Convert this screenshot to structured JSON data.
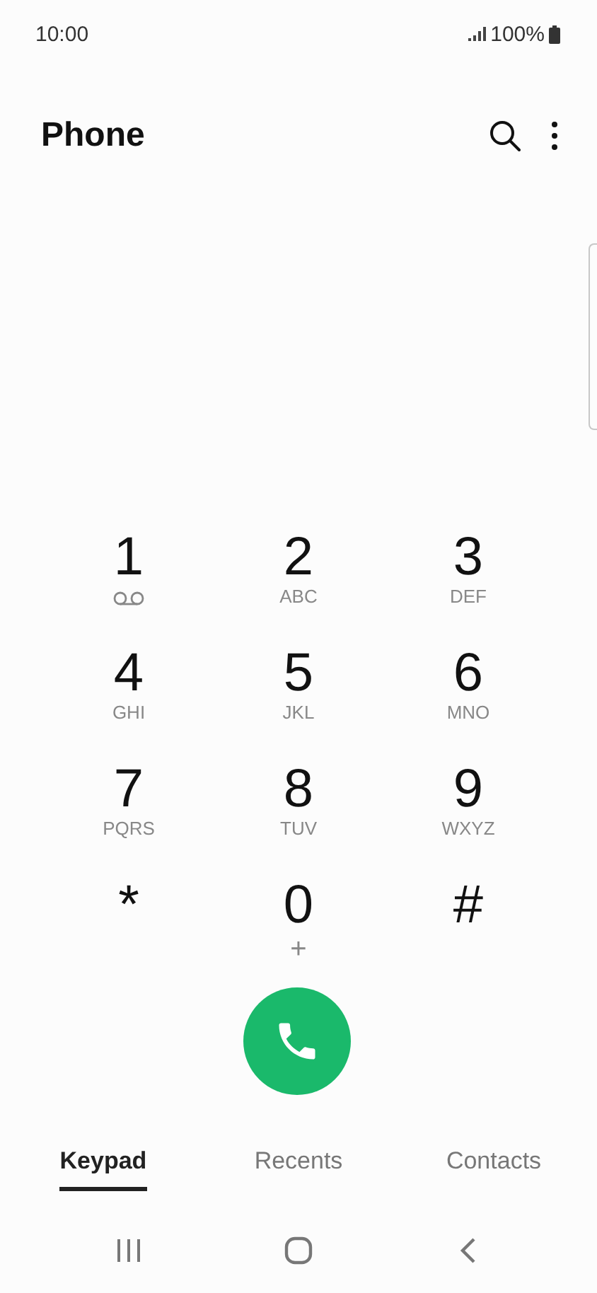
{
  "status_bar": {
    "time": "10:00",
    "battery": "100%"
  },
  "header": {
    "title": "Phone"
  },
  "keypad": [
    {
      "digit": "1",
      "kind": "voicemail"
    },
    {
      "digit": "2",
      "kind": "letters",
      "letters": "ABC"
    },
    {
      "digit": "3",
      "kind": "letters",
      "letters": "DEF"
    },
    {
      "digit": "4",
      "kind": "letters",
      "letters": "GHI"
    },
    {
      "digit": "5",
      "kind": "letters",
      "letters": "JKL"
    },
    {
      "digit": "6",
      "kind": "letters",
      "letters": "MNO"
    },
    {
      "digit": "7",
      "kind": "letters",
      "letters": "PQRS"
    },
    {
      "digit": "8",
      "kind": "letters",
      "letters": "TUV"
    },
    {
      "digit": "9",
      "kind": "letters",
      "letters": "WXYZ"
    },
    {
      "digit": "*",
      "kind": "none"
    },
    {
      "digit": "0",
      "kind": "letters",
      "letters": "+"
    },
    {
      "digit": "#",
      "kind": "none"
    }
  ],
  "tabs": [
    {
      "label": "Keypad",
      "selected": true
    },
    {
      "label": "Recents",
      "selected": false
    },
    {
      "label": "Contacts",
      "selected": false
    }
  ]
}
